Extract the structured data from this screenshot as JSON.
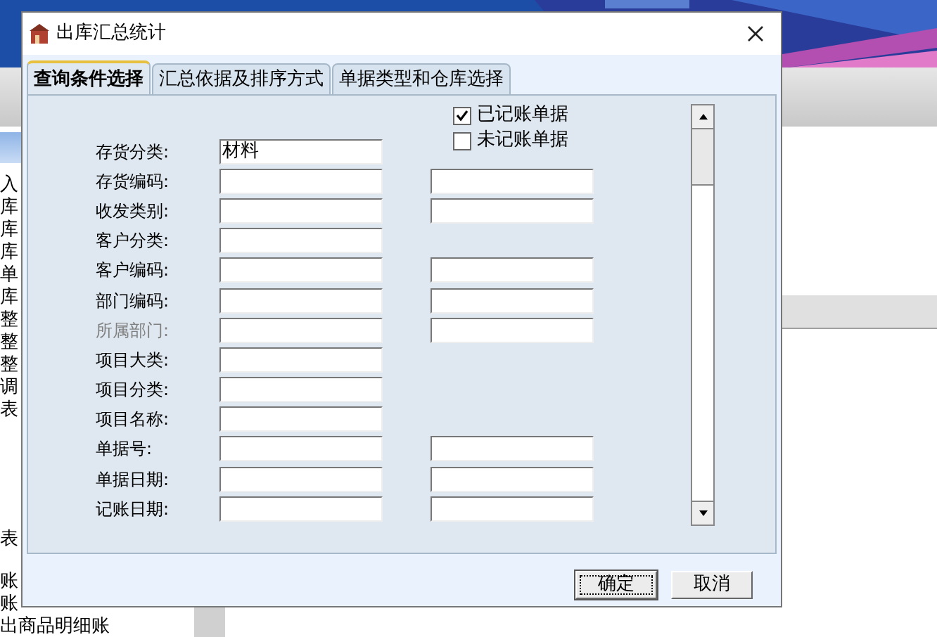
{
  "background_list": [
    "入",
    "库",
    "库",
    "库",
    "单",
    "库",
    "整",
    "整",
    "整",
    "调",
    "表",
    "表",
    "账",
    "账",
    "出商品明细账"
  ],
  "dialog": {
    "title": "出库汇总统计",
    "tabs": [
      {
        "label": "查询条件选择",
        "selected": true
      },
      {
        "label": "汇总依据及排序方式",
        "selected": false
      },
      {
        "label": "单据类型和仓库选择",
        "selected": false
      }
    ],
    "checkboxes": [
      {
        "label": "已记账单据",
        "checked": true
      },
      {
        "label": "未记账单据",
        "checked": false
      }
    ],
    "rows": [
      {
        "label": "存货分类:",
        "disabled": false,
        "kind": "single",
        "value": "材料"
      },
      {
        "label": "存货编码:",
        "disabled": false,
        "kind": "range"
      },
      {
        "label": "收发类别:",
        "disabled": false,
        "kind": "range"
      },
      {
        "label": "客户分类:",
        "disabled": false,
        "kind": "single"
      },
      {
        "label": "客户编码:",
        "disabled": false,
        "kind": "range"
      },
      {
        "label": "部门编码:",
        "disabled": false,
        "kind": "range"
      },
      {
        "label": "所属部门:",
        "disabled": true,
        "kind": "range"
      },
      {
        "label": "项目大类:",
        "disabled": false,
        "kind": "single"
      },
      {
        "label": "项目分类:",
        "disabled": false,
        "kind": "single"
      },
      {
        "label": "项目名称:",
        "disabled": false,
        "kind": "single"
      },
      {
        "label": "单据号:",
        "disabled": false,
        "kind": "range"
      },
      {
        "label": "单据日期:",
        "disabled": false,
        "kind": "range"
      },
      {
        "label": "记账日期:",
        "disabled": false,
        "kind": "range"
      }
    ],
    "buttons": [
      {
        "label": "确定",
        "focused": true
      },
      {
        "label": "取消",
        "focused": false
      }
    ]
  }
}
